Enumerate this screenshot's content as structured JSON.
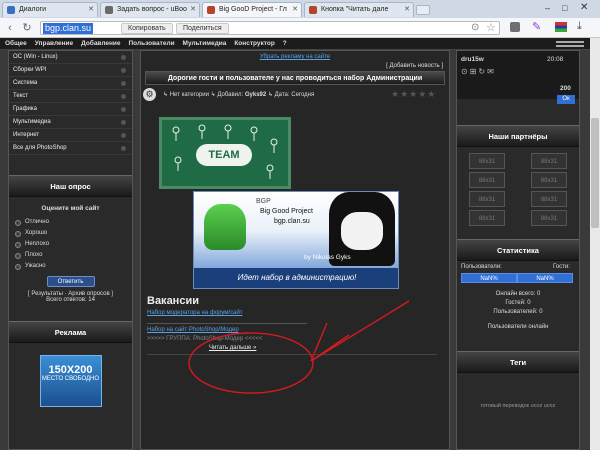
{
  "browser": {
    "tabs": [
      {
        "label": "Диалоги",
        "fav_color": "#3a70c4",
        "active": false
      },
      {
        "label": "Задать вопрос - uBoo",
        "fav_color": "#6a6a6a",
        "active": false
      },
      {
        "label": "Big GooD Project - Гл",
        "fav_color": "#b4442c",
        "active": true
      },
      {
        "label": "Кнопка \"Читать дале",
        "fav_color": "#b4442c",
        "active": false
      }
    ],
    "url": "bgp.clan.su",
    "copy_button": "Копировать",
    "share_button": "Поделиться"
  },
  "site_nav": [
    "Общее",
    "Управление",
    "Добавление",
    "Пользователи",
    "Мультимедиа",
    "Конструктор",
    "?"
  ],
  "left_menu": [
    "OC (Win - Linux)",
    "Сборки WPI",
    "Система",
    "Текст",
    "Графика",
    "Мультимедиа",
    "Интернет",
    "Все для PhotoShop"
  ],
  "poll": {
    "title": "Наш опрос",
    "question": "Оцените мой сайт",
    "options": [
      "Отлично",
      "Хорошо",
      "Неплохо",
      "Плохо",
      "Ужасно"
    ],
    "vote_button": "Ответить",
    "results_link": "[ Результаты · Архив опросов ]",
    "total": "Всего ответов: 14"
  },
  "ads": {
    "title": "Реклама",
    "banner_size": "150X200",
    "banner_text": "МЕСТО СВОБОДНО"
  },
  "content": {
    "ad_link": "Убрать рекламу на сайте",
    "add_news": "[ Добавить новость ]",
    "post_title": "Дорогие гости и пользователе у нас проводиться набор Администрации",
    "category": "Нет категории",
    "added_by_label": "Добавил:",
    "author": "Gyks92",
    "date_label": "Дата: Сегодня",
    "team_text": "TEAM",
    "banner_line1": "BGP",
    "banner_line2": "Big Good Project",
    "banner_line3": "bgp.clan.su",
    "banner_author": "by Nikolas Gyks",
    "banner_footer": "Идет набор в администрацию!",
    "vacancies_title": "Вакансии",
    "vacancy1": "Набор модератора на форум/сайт",
    "vacancy2": "Набор на сайт PhotoShop/Модер",
    "vacancy3": ">>>>> ГРУППА: PhotoShop-Модер <<<<<",
    "read_more": "Читать дальше »"
  },
  "right": {
    "user": "dru15w",
    "time": "20:08",
    "points": "200",
    "ok": "Ок",
    "partners_title": "Наши партнёры",
    "partner_label": "88x31",
    "stats_title": "Статистика",
    "users_label": "Пользователи:",
    "guests_label": "Гости:",
    "users_pct": "NaN%",
    "guests_pct": "NaN%",
    "online_total": "Онлайн всего: 0",
    "online_guests": "Гостей: 0",
    "online_users": "Пользователей: 0",
    "online_link": "Пользователи онлайн",
    "tags_title": "Теги",
    "tags_text": "готовый переводок ucoz ucoz"
  }
}
